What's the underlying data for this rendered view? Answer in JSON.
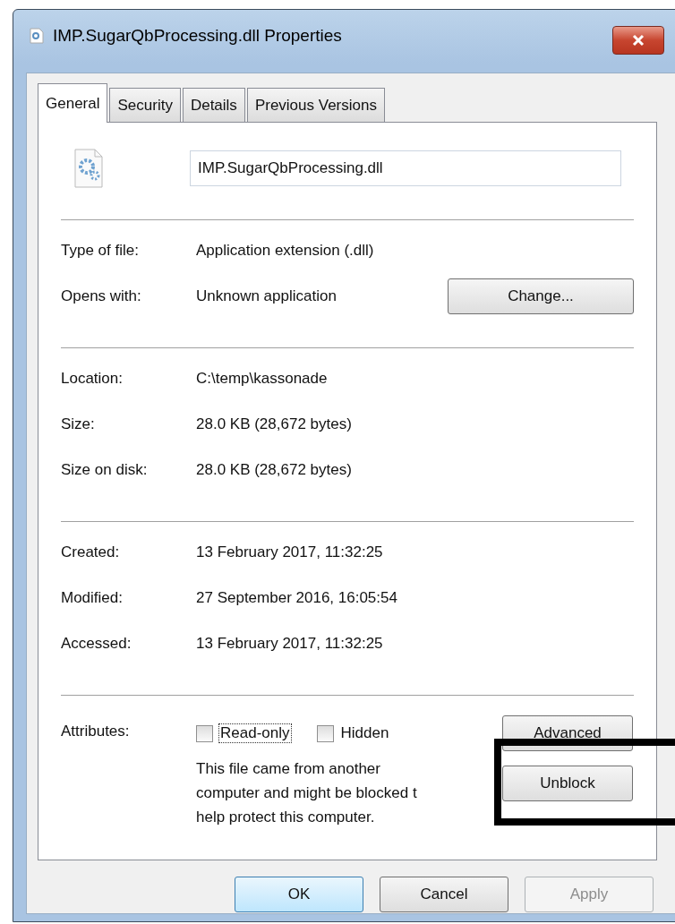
{
  "window": {
    "title": "IMP.SugarQbProcessing.dll Properties"
  },
  "tabs": [
    {
      "label": "General",
      "selected": true
    },
    {
      "label": "Security",
      "selected": false
    },
    {
      "label": "Details",
      "selected": false
    },
    {
      "label": "Previous Versions",
      "selected": false
    }
  ],
  "file_name": {
    "value": "IMP.SugarQbProcessing.dll"
  },
  "groups": [
    [
      {
        "label": "Type of file:",
        "value": "Application extension (.dll)"
      },
      {
        "label": "Opens with:",
        "value": "Unknown application",
        "button": "Change..."
      }
    ],
    [
      {
        "label": "Location:",
        "value": "C:\\temp\\kassonade"
      },
      {
        "label": "Size:",
        "value": "28.0 KB (28,672 bytes)"
      },
      {
        "label": "Size on disk:",
        "value": "28.0 KB (28,672 bytes)"
      }
    ],
    [
      {
        "label": "Created:",
        "value": "13 February 2017, 11:32:25"
      },
      {
        "label": "Modified:",
        "value": "27 September 2016, 16:05:54"
      },
      {
        "label": "Accessed:",
        "value": "13 February 2017, 11:32:25"
      }
    ]
  ],
  "attributes": {
    "label": "Attributes:",
    "checkboxes": [
      {
        "label": "Read-only",
        "checked": false,
        "focused": true
      },
      {
        "label": "Hidden",
        "checked": false,
        "focused": false
      }
    ],
    "advanced_button": "Advanced",
    "message_lines": [
      "This file came from another",
      "computer and might be blocked t",
      "help protect this computer."
    ],
    "unblock_button": "Unblock"
  },
  "buttons": [
    {
      "label": "OK",
      "kind": "default",
      "disabled": false
    },
    {
      "label": "Cancel",
      "kind": "normal",
      "disabled": false
    },
    {
      "label": "Apply",
      "kind": "normal",
      "disabled": true
    }
  ]
}
